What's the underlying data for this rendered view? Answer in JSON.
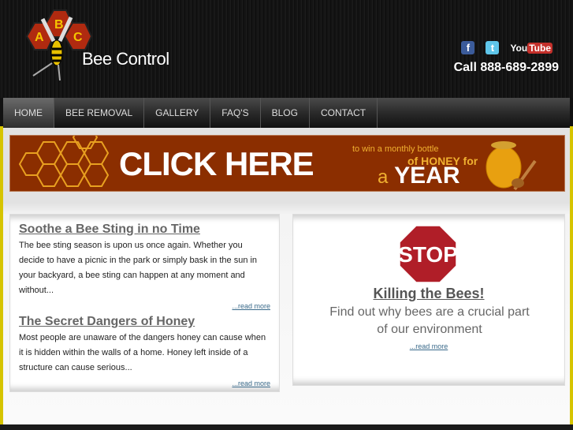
{
  "header": {
    "logo_letters": [
      "A",
      "B",
      "C"
    ],
    "brand": "Bee Control",
    "phone": "Call 888-689-2899",
    "social": [
      {
        "icon": "facebook-icon",
        "glyph": "f"
      },
      {
        "icon": "twitter-icon",
        "glyph": "t"
      },
      {
        "icon": "youtube-icon",
        "you": "You",
        "tube": "Tube"
      }
    ]
  },
  "nav": {
    "items": [
      "HOME",
      "BEE REMOVAL",
      "GALLERY",
      "FAQ'S",
      "BLOG",
      "CONTACT"
    ],
    "active": "HOME"
  },
  "banner": {
    "cta": "CLICK HERE",
    "line1": "to win a monthly bottle",
    "line2": "of HONEY for",
    "line3a": "a",
    "line3b": "YEAR",
    "color": "#8b2e00"
  },
  "posts": [
    {
      "title": "Soothe a Bee Sting in no Time",
      "text": "The bee sting season is upon us once again. Whether you decide to have a picnic in the park or simply bask in the sun in your backyard, a bee sting can happen at any moment and without...",
      "more": "...read more"
    },
    {
      "title": "The Secret Dangers of Honey",
      "text": "Most people are unaware of the dangers honey can cause when it is hidden within the walls of a home.  Honey left inside of a structure can cause serious...",
      "more": "...read more"
    }
  ],
  "feature": {
    "sign": "STOP",
    "title": "Killing the Bees!",
    "text": "Find out why bees are a crucial part of our environment",
    "more": "...read more"
  }
}
